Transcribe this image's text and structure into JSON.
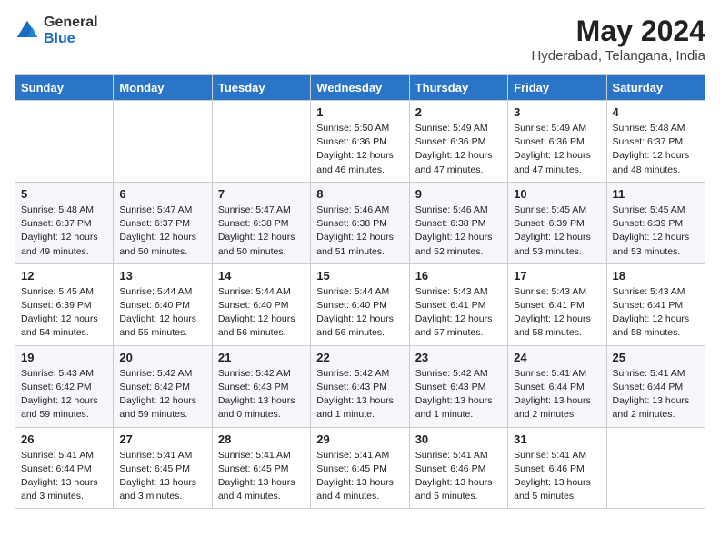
{
  "logo": {
    "general": "General",
    "blue": "Blue"
  },
  "title": {
    "month_year": "May 2024",
    "location": "Hyderabad, Telangana, India"
  },
  "weekdays": [
    "Sunday",
    "Monday",
    "Tuesday",
    "Wednesday",
    "Thursday",
    "Friday",
    "Saturday"
  ],
  "weeks": [
    [
      {
        "day": "",
        "info": ""
      },
      {
        "day": "",
        "info": ""
      },
      {
        "day": "",
        "info": ""
      },
      {
        "day": "1",
        "info": "Sunrise: 5:50 AM\nSunset: 6:36 PM\nDaylight: 12 hours\nand 46 minutes."
      },
      {
        "day": "2",
        "info": "Sunrise: 5:49 AM\nSunset: 6:36 PM\nDaylight: 12 hours\nand 47 minutes."
      },
      {
        "day": "3",
        "info": "Sunrise: 5:49 AM\nSunset: 6:36 PM\nDaylight: 12 hours\nand 47 minutes."
      },
      {
        "day": "4",
        "info": "Sunrise: 5:48 AM\nSunset: 6:37 PM\nDaylight: 12 hours\nand 48 minutes."
      }
    ],
    [
      {
        "day": "5",
        "info": "Sunrise: 5:48 AM\nSunset: 6:37 PM\nDaylight: 12 hours\nand 49 minutes."
      },
      {
        "day": "6",
        "info": "Sunrise: 5:47 AM\nSunset: 6:37 PM\nDaylight: 12 hours\nand 50 minutes."
      },
      {
        "day": "7",
        "info": "Sunrise: 5:47 AM\nSunset: 6:38 PM\nDaylight: 12 hours\nand 50 minutes."
      },
      {
        "day": "8",
        "info": "Sunrise: 5:46 AM\nSunset: 6:38 PM\nDaylight: 12 hours\nand 51 minutes."
      },
      {
        "day": "9",
        "info": "Sunrise: 5:46 AM\nSunset: 6:38 PM\nDaylight: 12 hours\nand 52 minutes."
      },
      {
        "day": "10",
        "info": "Sunrise: 5:45 AM\nSunset: 6:39 PM\nDaylight: 12 hours\nand 53 minutes."
      },
      {
        "day": "11",
        "info": "Sunrise: 5:45 AM\nSunset: 6:39 PM\nDaylight: 12 hours\nand 53 minutes."
      }
    ],
    [
      {
        "day": "12",
        "info": "Sunrise: 5:45 AM\nSunset: 6:39 PM\nDaylight: 12 hours\nand 54 minutes."
      },
      {
        "day": "13",
        "info": "Sunrise: 5:44 AM\nSunset: 6:40 PM\nDaylight: 12 hours\nand 55 minutes."
      },
      {
        "day": "14",
        "info": "Sunrise: 5:44 AM\nSunset: 6:40 PM\nDaylight: 12 hours\nand 56 minutes."
      },
      {
        "day": "15",
        "info": "Sunrise: 5:44 AM\nSunset: 6:40 PM\nDaylight: 12 hours\nand 56 minutes."
      },
      {
        "day": "16",
        "info": "Sunrise: 5:43 AM\nSunset: 6:41 PM\nDaylight: 12 hours\nand 57 minutes."
      },
      {
        "day": "17",
        "info": "Sunrise: 5:43 AM\nSunset: 6:41 PM\nDaylight: 12 hours\nand 58 minutes."
      },
      {
        "day": "18",
        "info": "Sunrise: 5:43 AM\nSunset: 6:41 PM\nDaylight: 12 hours\nand 58 minutes."
      }
    ],
    [
      {
        "day": "19",
        "info": "Sunrise: 5:43 AM\nSunset: 6:42 PM\nDaylight: 12 hours\nand 59 minutes."
      },
      {
        "day": "20",
        "info": "Sunrise: 5:42 AM\nSunset: 6:42 PM\nDaylight: 12 hours\nand 59 minutes."
      },
      {
        "day": "21",
        "info": "Sunrise: 5:42 AM\nSunset: 6:43 PM\nDaylight: 13 hours\nand 0 minutes."
      },
      {
        "day": "22",
        "info": "Sunrise: 5:42 AM\nSunset: 6:43 PM\nDaylight: 13 hours\nand 1 minute."
      },
      {
        "day": "23",
        "info": "Sunrise: 5:42 AM\nSunset: 6:43 PM\nDaylight: 13 hours\nand 1 minute."
      },
      {
        "day": "24",
        "info": "Sunrise: 5:41 AM\nSunset: 6:44 PM\nDaylight: 13 hours\nand 2 minutes."
      },
      {
        "day": "25",
        "info": "Sunrise: 5:41 AM\nSunset: 6:44 PM\nDaylight: 13 hours\nand 2 minutes."
      }
    ],
    [
      {
        "day": "26",
        "info": "Sunrise: 5:41 AM\nSunset: 6:44 PM\nDaylight: 13 hours\nand 3 minutes."
      },
      {
        "day": "27",
        "info": "Sunrise: 5:41 AM\nSunset: 6:45 PM\nDaylight: 13 hours\nand 3 minutes."
      },
      {
        "day": "28",
        "info": "Sunrise: 5:41 AM\nSunset: 6:45 PM\nDaylight: 13 hours\nand 4 minutes."
      },
      {
        "day": "29",
        "info": "Sunrise: 5:41 AM\nSunset: 6:45 PM\nDaylight: 13 hours\nand 4 minutes."
      },
      {
        "day": "30",
        "info": "Sunrise: 5:41 AM\nSunset: 6:46 PM\nDaylight: 13 hours\nand 5 minutes."
      },
      {
        "day": "31",
        "info": "Sunrise: 5:41 AM\nSunset: 6:46 PM\nDaylight: 13 hours\nand 5 minutes."
      },
      {
        "day": "",
        "info": ""
      }
    ]
  ]
}
